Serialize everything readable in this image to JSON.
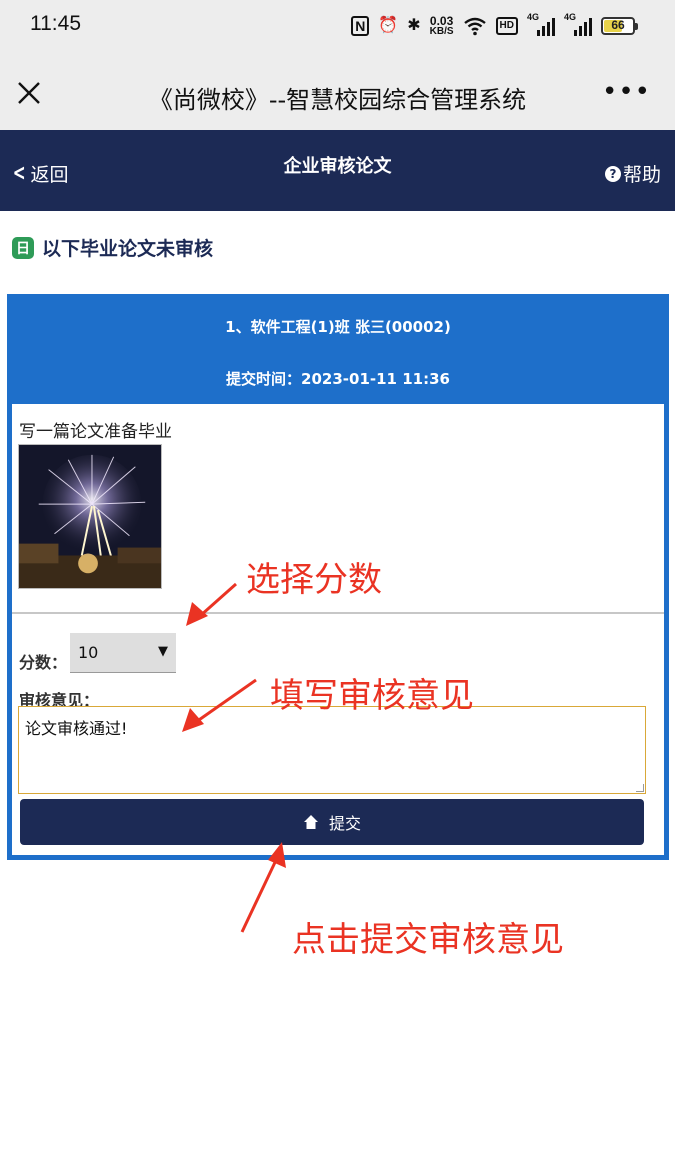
{
  "status_bar": {
    "time": "11:45",
    "nfc": "N",
    "alarm": "⏰",
    "bluetooth": "✱",
    "net_speed_value": "0.03",
    "net_speed_unit": "KB/S",
    "wifi": "Ꮫ",
    "hd_badge": "HD",
    "signal1_label": "4G",
    "signal2_label": "4G",
    "battery_level": "66",
    "battery_fraction": 0.66
  },
  "wechat_bar": {
    "close_icon": "close-icon",
    "title": "《尚微校》--智慧校园综合管理系统",
    "more_label": "•••"
  },
  "nav": {
    "back_label": "返回",
    "back_chevron": "<",
    "title": "企业审核论文",
    "help_label": "帮助",
    "help_glyph": "?"
  },
  "section": {
    "icon_glyph": "日",
    "heading": "以下毕业论文未审核"
  },
  "card": {
    "student": "1、软件工程(1)班 张三(00002)",
    "submit_time": "提交时间：2023-01-11 11:36",
    "thesis_title": "写一篇论文准备毕业",
    "score_label": "分数：",
    "score_value": "10",
    "score_arrow": "▼",
    "comment_label": "审核意见：",
    "comment_value": "论文审核通过!",
    "submit_icon": "⬆",
    "submit_label": "提交"
  },
  "annotations": {
    "choose_score": "选择分数",
    "fill_comment": "填写审核意见",
    "click_submit": "点击提交审核意见",
    "color": "#ea3323"
  },
  "colors": {
    "navbar": "#1c2a55",
    "card_border": "#1e6fca",
    "section_icon": "#2e9b57",
    "comment_border": "#d9a838"
  }
}
